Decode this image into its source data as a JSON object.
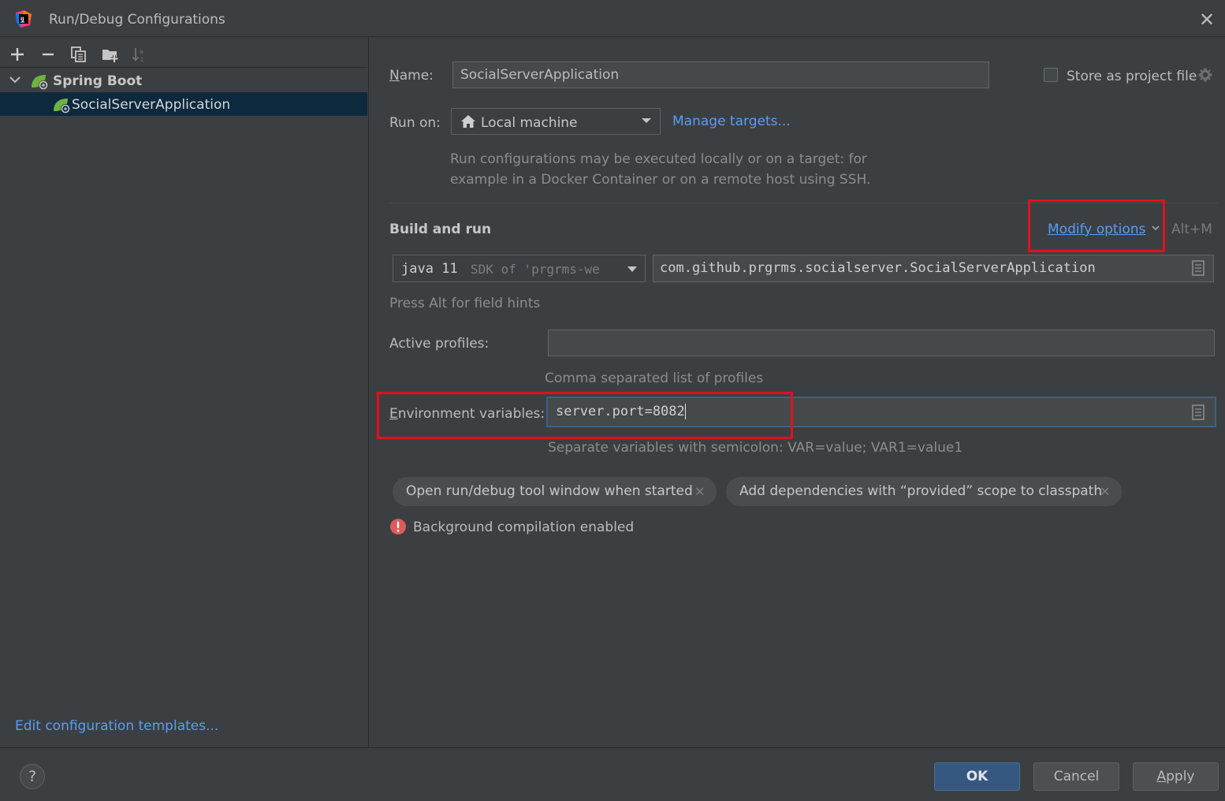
{
  "window": {
    "title": "Run/Debug Configurations"
  },
  "left_panel": {
    "tree": {
      "group_label": "Spring Boot",
      "item_label": "SocialServerApplication"
    },
    "edit_templates_link": "Edit configuration templates..."
  },
  "config": {
    "name_label": "Name:",
    "name_value": "SocialServerApplication",
    "store_label": "Store as project file",
    "store_checked": false,
    "run_on_label": "Run on:",
    "run_on_value": "Local machine",
    "manage_targets_link": "Manage targets...",
    "run_on_hint_line1": "Run configurations may be executed locally or on a target: for",
    "run_on_hint_line2": "example in a Docker Container or on a remote host using SSH.",
    "build_title": "Build and run",
    "modify_options_link": "Modify options",
    "modify_options_shortcut": "Alt+M",
    "sdk_main": "java 11",
    "sdk_detail": "SDK of 'prgrms-we",
    "main_class": "com.github.prgrms.socialserver.SocialServerApplication",
    "field_hint": "Press Alt for field hints",
    "active_profiles_label": "Active profiles:",
    "active_profiles_value": "",
    "active_profiles_hint": "Comma separated list of profiles",
    "env_label": "Environment variables:",
    "env_value": "server.port=8082",
    "env_hint": "Separate variables with semicolon: VAR=value; VAR1=value1",
    "chips": [
      {
        "label": "Open run/debug tool window when started"
      },
      {
        "label": "Add dependencies with “provided” scope to classpath"
      }
    ],
    "warning_text": "Background compilation enabled"
  },
  "buttons": {
    "help": "?",
    "ok": "OK",
    "cancel": "Cancel",
    "apply": "Apply"
  },
  "colors": {
    "background": "#3c3f41",
    "link": "#589df6",
    "selection": "#0d293e",
    "highlight_box": "#e3101e",
    "primary_button": "#365880",
    "spring_green": "#6db33f",
    "warning_red": "#db5c5c"
  },
  "icons": [
    "app-logo",
    "close-icon",
    "add-icon",
    "remove-icon",
    "copy-icon",
    "folder-add-icon",
    "sort-icon",
    "chevron-down-icon",
    "spring-boot-icon",
    "gear-icon",
    "home-icon",
    "expand-icon",
    "error-icon",
    "close-chip-icon"
  ]
}
